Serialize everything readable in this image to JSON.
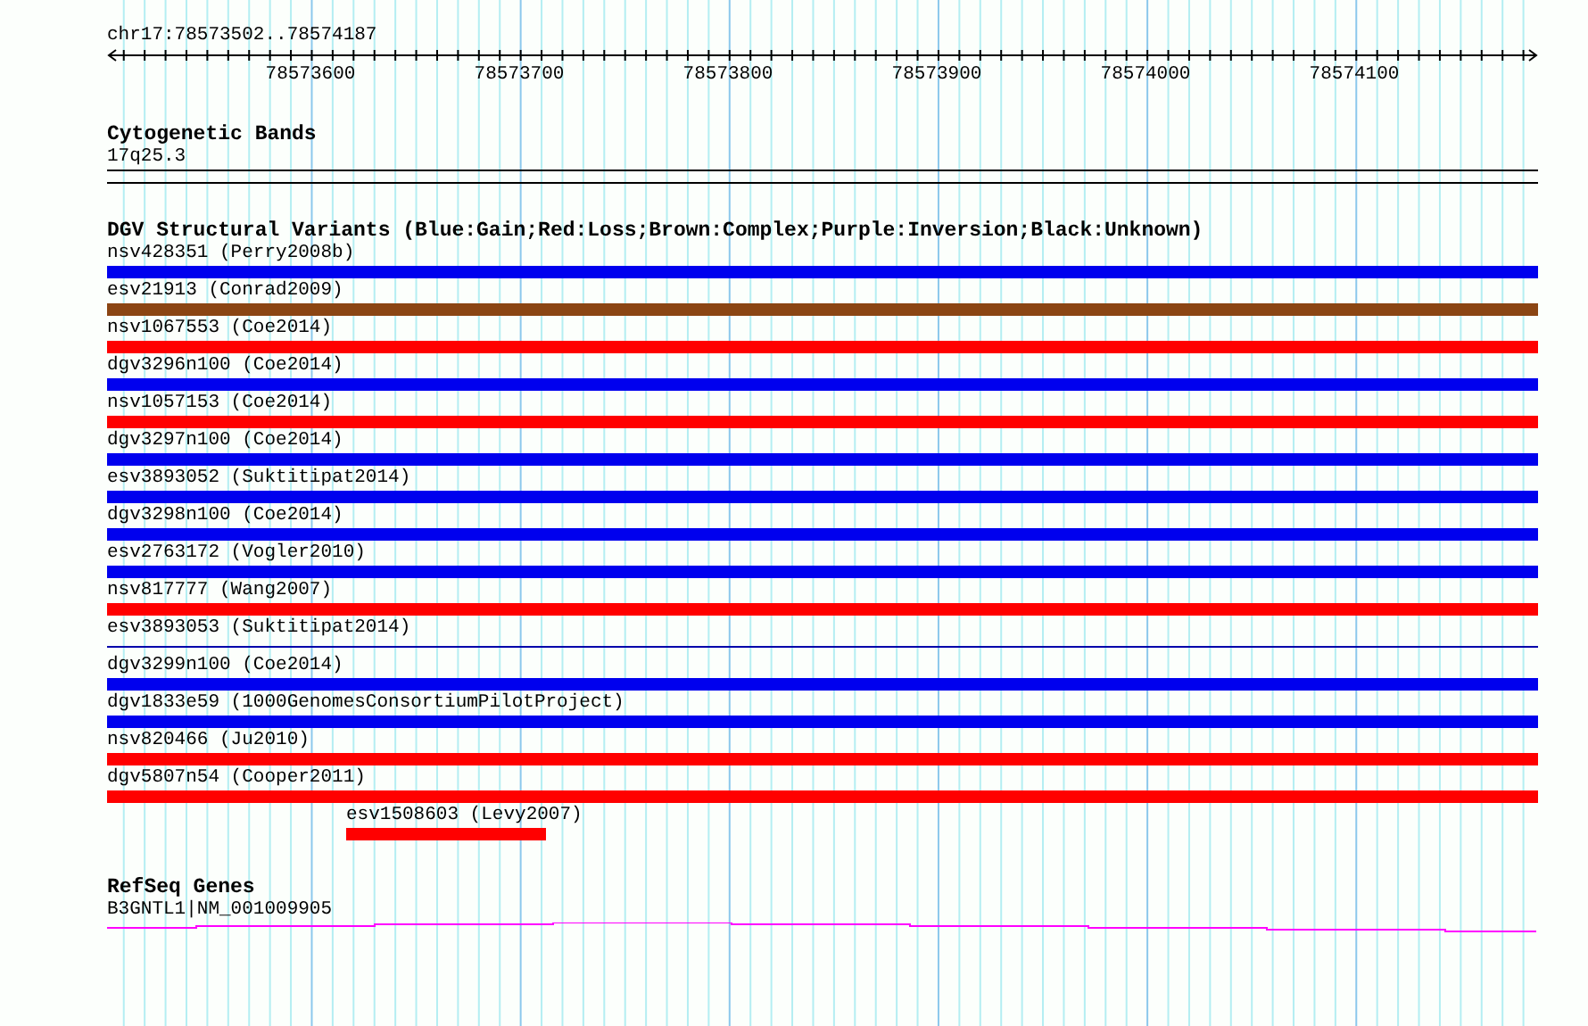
{
  "ruler": {
    "position": "chr17:78573502..78574187",
    "ticks": [
      "78573600",
      "78573700",
      "78573800",
      "78573900",
      "78574000",
      "78574100"
    ]
  },
  "cytogenetic_bands": {
    "title": "Cytogenetic Bands",
    "band": "17q25.3"
  },
  "dgv": {
    "title": "DGV Structural Variants (Blue:Gain;Red:Loss;Brown:Complex;Purple:Inversion;Black:Unknown)",
    "variants": [
      {
        "label": "nsv428351 (Perry2008b)",
        "kind": "bar",
        "color": "#0000ee"
      },
      {
        "label": "esv21913 (Conrad2009)",
        "kind": "bar",
        "color": "#8b4513"
      },
      {
        "label": "nsv1067553 (Coe2014)",
        "kind": "bar",
        "color": "#ff0000"
      },
      {
        "label": "dgv3296n100 (Coe2014)",
        "kind": "bar",
        "color": "#0000ee"
      },
      {
        "label": "nsv1057153 (Coe2014)",
        "kind": "bar",
        "color": "#ff0000"
      },
      {
        "label": "dgv3297n100 (Coe2014)",
        "kind": "bar",
        "color": "#0000ee"
      },
      {
        "label": "esv3893052 (Suktitipat2014)",
        "kind": "bar",
        "color": "#0000ee"
      },
      {
        "label": "dgv3298n100 (Coe2014)",
        "kind": "bar",
        "color": "#0000ee"
      },
      {
        "label": "esv2763172 (Vogler2010)",
        "kind": "bar",
        "color": "#0000ee"
      },
      {
        "label": "nsv817777 (Wang2007)",
        "kind": "bar",
        "color": "#ff0000"
      },
      {
        "label": "esv3893053 (Suktitipat2014)",
        "kind": "line",
        "color": "#0000aa"
      },
      {
        "label": "dgv3299n100 (Coe2014)",
        "kind": "bar",
        "color": "#0000ee"
      },
      {
        "label": "dgv1833e59 (1000GenomesConsortiumPilotProject)",
        "kind": "bar",
        "color": "#0000ee"
      },
      {
        "label": "nsv820466 (Ju2010)",
        "kind": "bar",
        "color": "#ff0000"
      },
      {
        "label": "dgv5807n54 (Cooper2011)",
        "kind": "bar",
        "color": "#ff0000"
      },
      {
        "label": "esv1508603 (Levy2007)",
        "kind": "partial",
        "color": "#ff0000"
      }
    ]
  },
  "refseq": {
    "title": "RefSeq Genes",
    "gene": "B3GNTL1|NM_001009905"
  }
}
